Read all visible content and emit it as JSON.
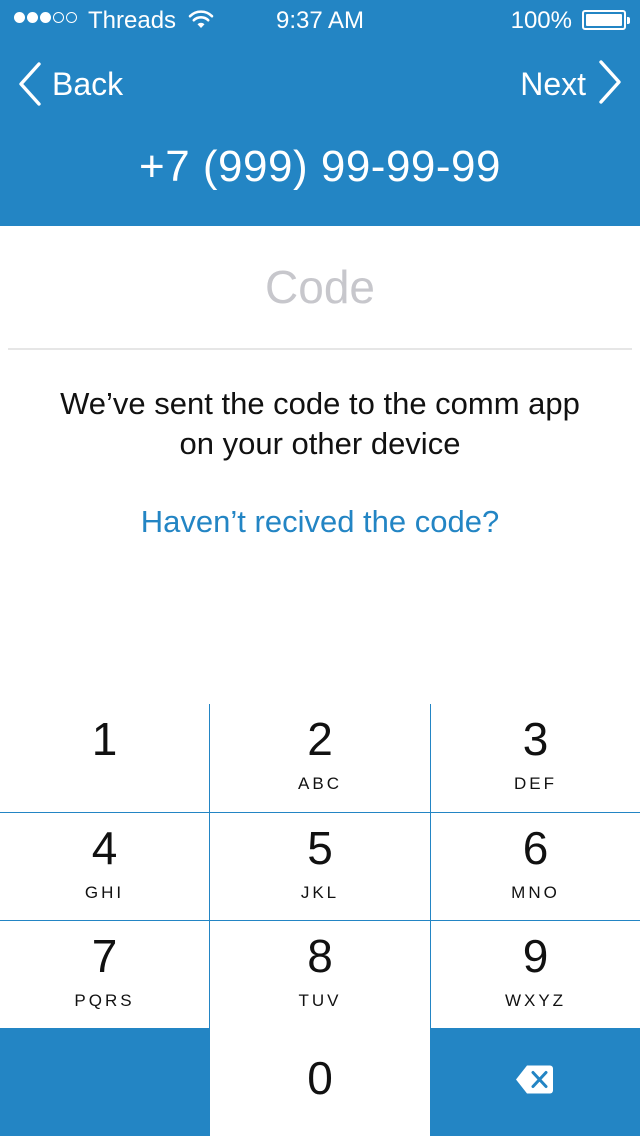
{
  "status_bar": {
    "carrier": "Threads",
    "time": "9:37 AM",
    "battery_percent": "100%",
    "signal_bars_filled": 3,
    "signal_bars_total": 5
  },
  "nav": {
    "back_label": "Back",
    "next_label": "Next"
  },
  "header": {
    "phone_number": "+7 (999) 99-99-99"
  },
  "code": {
    "placeholder": "Code",
    "value": ""
  },
  "message": "We’ve sent the code to the comm app on your other device",
  "resend_link": "Haven’t recived the code?",
  "keypad": {
    "keys": [
      {
        "digit": "1",
        "letters": ""
      },
      {
        "digit": "2",
        "letters": "ABC"
      },
      {
        "digit": "3",
        "letters": "DEF"
      },
      {
        "digit": "4",
        "letters": "GHI"
      },
      {
        "digit": "5",
        "letters": "JKL"
      },
      {
        "digit": "6",
        "letters": "MNO"
      },
      {
        "digit": "7",
        "letters": "PQRS"
      },
      {
        "digit": "8",
        "letters": "TUV"
      },
      {
        "digit": "9",
        "letters": "WXYZ"
      },
      {
        "digit": "0",
        "letters": ""
      }
    ],
    "delete_icon": "backspace-icon"
  },
  "colors": {
    "accent": "#2385c4",
    "text": "#111111",
    "placeholder": "#c7c7cc",
    "divider": "#e6e6e6"
  }
}
